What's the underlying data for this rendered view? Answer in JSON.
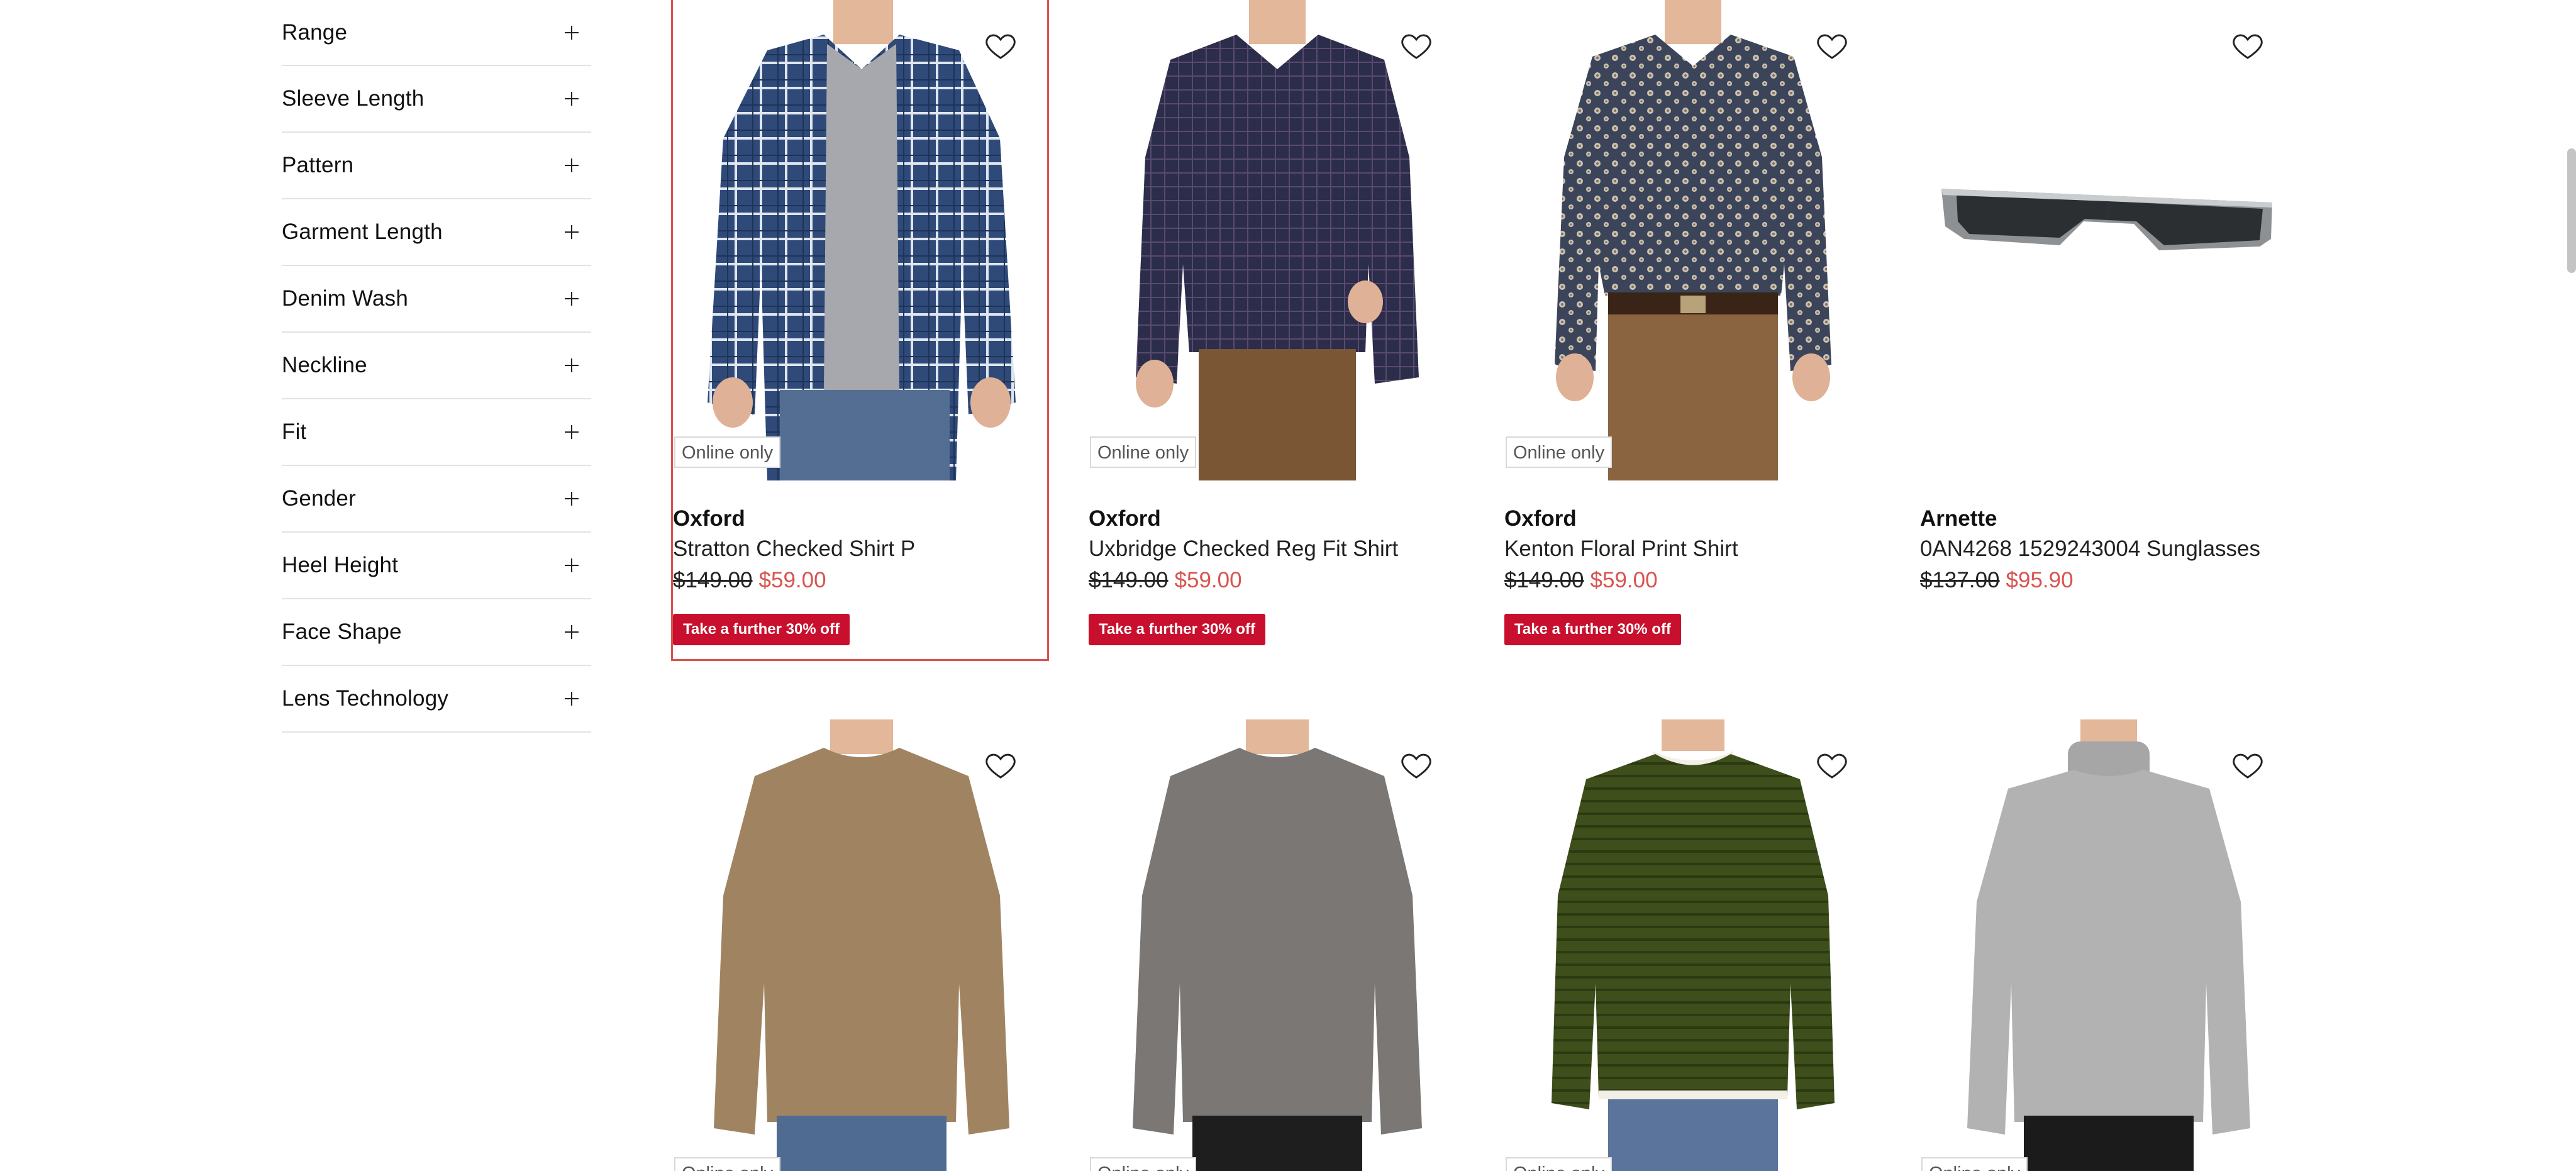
{
  "filters": [
    "Range",
    "Sleeve Length",
    "Pattern",
    "Garment Length",
    "Denim Wash",
    "Neckline",
    "Fit",
    "Gender",
    "Heel Height",
    "Face Shape",
    "Lens Technology"
  ],
  "products": [
    {
      "badge": "Online only",
      "brand": "Oxford",
      "name": "Stratton Checked Shirt P",
      "was_price": "$149.00",
      "now_price": "$59.00",
      "promo": "Take a further 30% off"
    },
    {
      "badge": "Online only",
      "brand": "Oxford",
      "name": "Uxbridge Checked Reg Fit Shirt",
      "was_price": "$149.00",
      "now_price": "$59.00",
      "promo": "Take a further 30% off"
    },
    {
      "badge": "Online only",
      "brand": "Oxford",
      "name": "Kenton Floral Print Shirt",
      "was_price": "$149.00",
      "now_price": "$59.00",
      "promo": "Take a further 30% off"
    },
    {
      "brand": "Arnette",
      "name": "0AN4268 1529243004 Sunglasses",
      "was_price": "$137.00",
      "now_price": "$95.90"
    }
  ],
  "second_row": [
    {
      "badge": "Online only"
    },
    {
      "badge": "Online only"
    },
    {
      "badge": "Online only"
    },
    {
      "badge": "Online only"
    }
  ],
  "colors": {
    "sale_price": "#d9534f",
    "promo_bg": "#c8102e",
    "active_outline": "#d9534f"
  },
  "icons": {
    "wishlist": "heart-outline-icon",
    "expand": "plus-icon"
  }
}
